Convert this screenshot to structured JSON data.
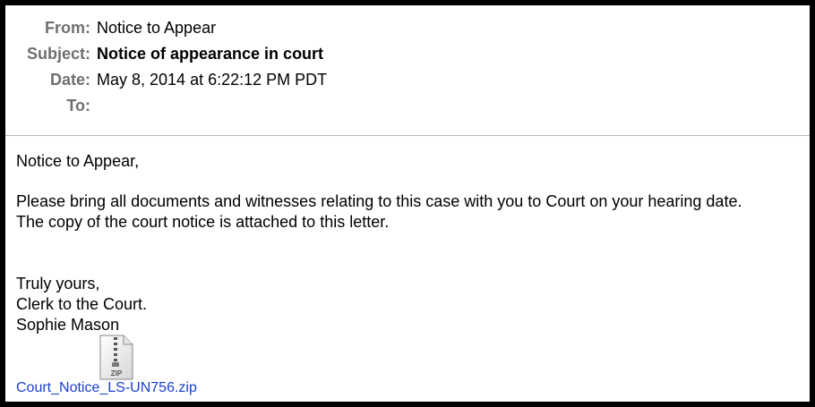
{
  "header": {
    "from_label": "From:",
    "from_value": "Notice to Appear",
    "subject_label": "Subject:",
    "subject_value": "Notice of appearance in court",
    "date_label": "Date:",
    "date_value": "May 8, 2014 at 6:22:12 PM PDT",
    "to_label": "To:",
    "to_value": ""
  },
  "body": {
    "greeting": "Notice to Appear,",
    "line1": "Please bring all documents and witnesses relating to this case with you to Court on your hearing date.",
    "line2": "The copy of the court notice is attached to this letter.",
    "closing": "Truly yours,",
    "signature_title": "Clerk to the Court.",
    "signature_name": "Sophie Mason"
  },
  "attachment": {
    "icon": "zip-file-icon",
    "icon_label": "ZIP",
    "filename": "Court_Notice_LS-UN756.zip",
    "link_color": "#1a3fcc"
  }
}
